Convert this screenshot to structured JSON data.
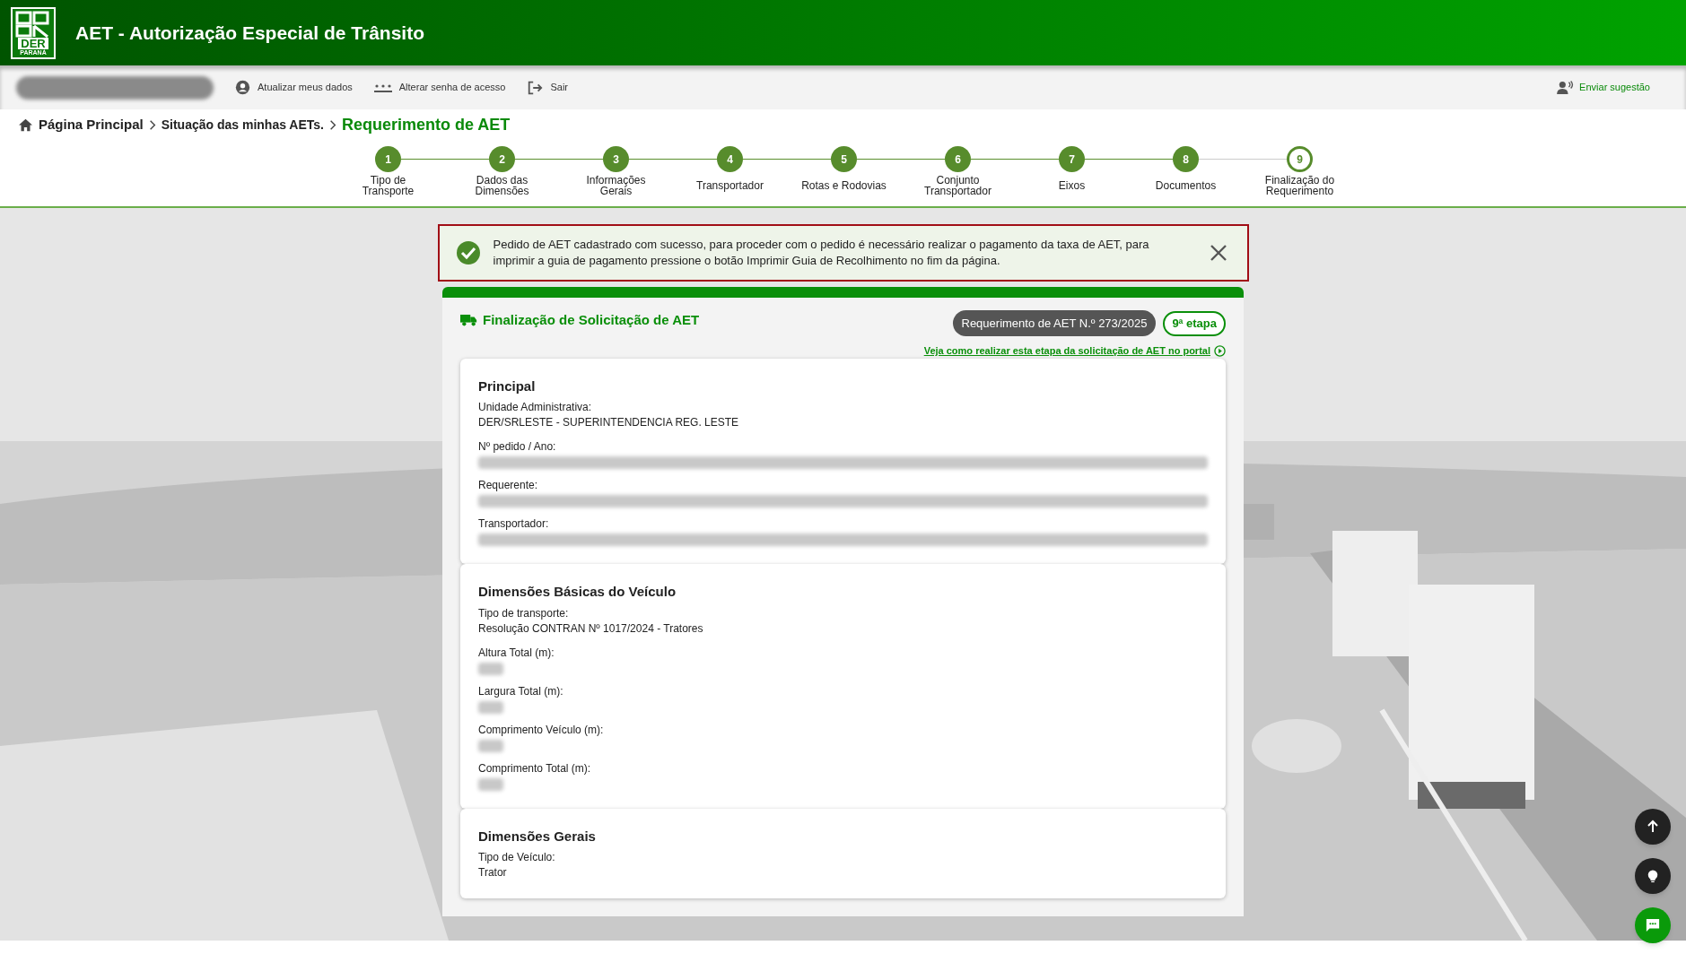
{
  "header": {
    "title": "AET - Autorização Especial de Trânsito",
    "logo": {
      "top": "DER",
      "bottom": "PARANÁ"
    }
  },
  "toolbar": {
    "items": [
      "Atualizar meus dados",
      "Alterar senha de acesso",
      "Sair"
    ],
    "suggestion": "Enviar sugestão"
  },
  "breadcrumb": {
    "items": [
      "Página Principal",
      "Situação das minhas AETs."
    ],
    "current": "Requerimento de AET"
  },
  "steps": [
    {
      "number": "1",
      "label": "Tipo de Transporte",
      "completed": true
    },
    {
      "number": "2",
      "label": "Dados das Dimensões",
      "completed": true
    },
    {
      "number": "3",
      "label": "Informações Gerais",
      "completed": true
    },
    {
      "number": "4",
      "label": "Transportador",
      "completed": true
    },
    {
      "number": "5",
      "label": "Rotas e Rodovias",
      "completed": true
    },
    {
      "number": "6",
      "label": "Conjunto Transportador",
      "completed": true
    },
    {
      "number": "7",
      "label": "Eixos",
      "completed": true
    },
    {
      "number": "8",
      "label": "Documentos",
      "completed": true
    },
    {
      "number": "9",
      "label": "Finalização do Requerimento",
      "completed": false
    }
  ],
  "alert": {
    "message": "Pedido de AET cadastrado com sucesso, para proceder com o pedido é necessário realizar o pagamento da taxa de AET, para imprimir a guia de pagamento pressione o botão Imprimir Guia de Recolhimento no fim da página."
  },
  "panel": {
    "title": "Finalização de Solicitação de AET",
    "request_badge": "Requerimento de AET N.º 273/2025",
    "stage_badge": "9ª etapa",
    "help_link": "Veja como realizar esta etapa da solicitação de AET no portal",
    "sections": [
      {
        "title": "Principal",
        "fields": [
          {
            "label": "Unidade Administrativa:",
            "value": "DER/SRLESTE - SUPERINTENDENCIA REG. LESTE",
            "redacted": false
          },
          {
            "label": "Nº pedido / Ano:",
            "redacted": true
          },
          {
            "label": "Requerente:",
            "redacted": true
          },
          {
            "label": "Transportador:",
            "redacted": true
          }
        ]
      },
      {
        "title": "Dimensões Básicas do Veículo",
        "fields": [
          {
            "label": "Tipo de transporte:",
            "value": "Resolução CONTRAN Nº 1017/2024 - Tratores",
            "redacted": false
          },
          {
            "label": "Altura Total (m):",
            "redacted": true
          },
          {
            "label": "Largura Total (m):",
            "redacted": true
          },
          {
            "label": "Comprimento Veículo (m):",
            "redacted": true
          },
          {
            "label": "Comprimento Total (m):",
            "redacted": true
          }
        ]
      },
      {
        "title": "Dimensões Gerais",
        "fields": [
          {
            "label": "Tipo de Veículo:",
            "value": "Trator",
            "redacted": false
          }
        ]
      }
    ]
  }
}
